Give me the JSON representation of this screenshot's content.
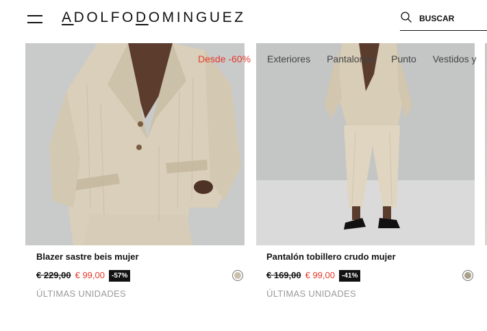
{
  "header": {
    "logo": {
      "part1": "A",
      "part2": "DOLFO",
      "part3": "D",
      "part4": "OMINGUEZ"
    },
    "search": {
      "placeholder": "BUSCAR"
    }
  },
  "filters": [
    "Desde -60%",
    "Exteriores",
    "Pantalones",
    "Punto",
    "Vestidos y"
  ],
  "products": [
    {
      "name": "Blazer sastre beis mujer",
      "old_price": "€ 229,00",
      "new_price": "€ 99,00",
      "discount": "-57%",
      "stock": "ÚLTIMAS UNIDADES",
      "swatch_color": "#c9c0ad"
    },
    {
      "name": "Pantalón tobillero crudo mujer",
      "old_price": "€ 169,00",
      "new_price": "€ 99,00",
      "discount": "-41%",
      "stock": "ÚLTIMAS UNIDADES",
      "swatch_color": "#a9a08c"
    }
  ],
  "colors": {
    "accent": "#e5392b",
    "text": "#111111",
    "muted": "#999999"
  }
}
